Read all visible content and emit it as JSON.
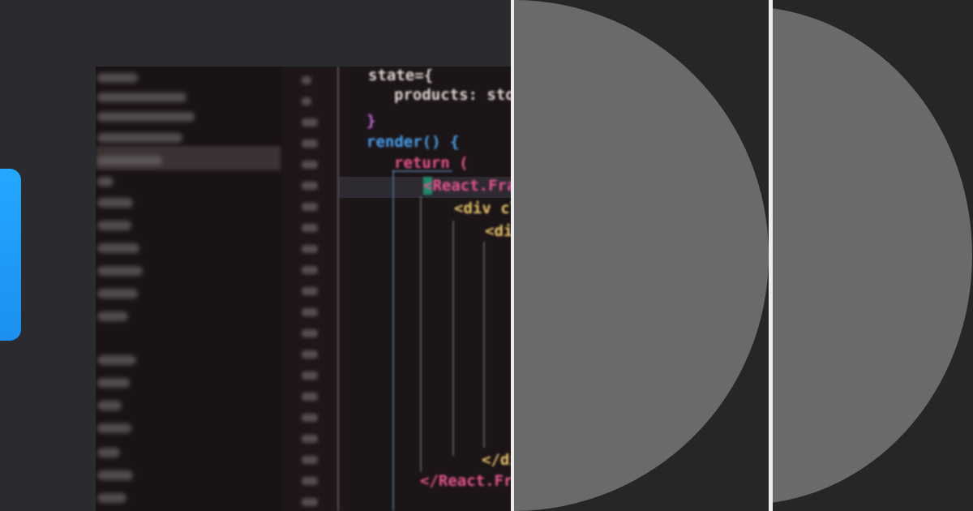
{
  "code": {
    "lines": [
      {
        "text": "state={",
        "class": "kw-white"
      },
      {
        "text": "products: store",
        "class": "kw-white"
      },
      {
        "text": "}",
        "class": "kw-purple"
      },
      {
        "text": "render() {",
        "class": "kw-blue"
      },
      {
        "text": "return (",
        "class": "kw-pink"
      },
      {
        "text": "<React.Frag",
        "class": "kw-pink"
      },
      {
        "text": "<div cla",
        "class": "kw-yellow"
      },
      {
        "text": "<di",
        "class": "kw-yellow"
      },
      {
        "text": "</di",
        "class": "kw-yellow"
      },
      {
        "text": "</React.Frag",
        "class": "kw-pink"
      }
    ]
  },
  "colors": {
    "accent_tab": "#1b90f0",
    "placeholder_fill": "#6a6a6a",
    "panel_bg": "#262626",
    "page_bg": "#2a2a2f"
  },
  "panels": [
    {
      "name": "placeholder-image-1",
      "shape": "half-circle"
    },
    {
      "name": "placeholder-image-2",
      "shape": "half-circle"
    }
  ]
}
